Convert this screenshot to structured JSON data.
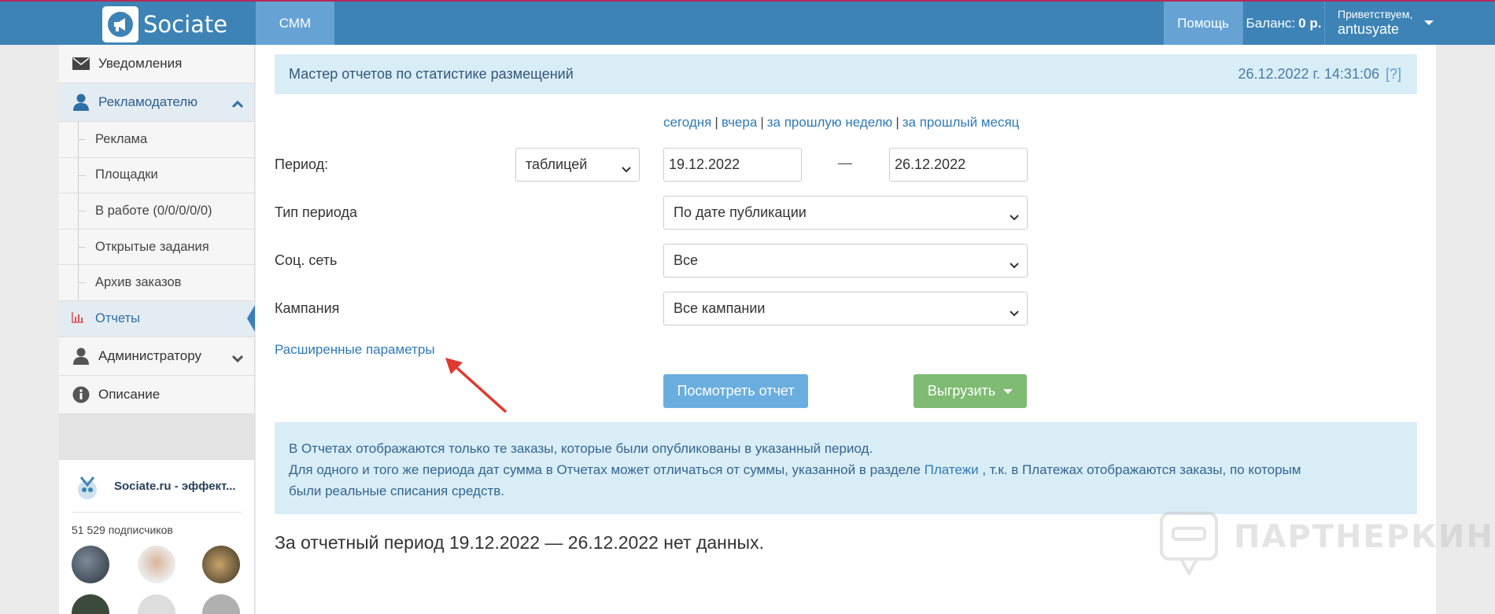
{
  "navbar": {
    "logo_text": "Sociate",
    "smm": "СММ",
    "help": "Помощь",
    "balance_label": "Баланс:",
    "balance_value": "0 р.",
    "greeting": "Приветствуем,",
    "username": "antusyate"
  },
  "sidebar": {
    "notifications": "Уведомления",
    "advertiser": "Рекламодателю",
    "sub": [
      "Реклама",
      "Площадки",
      "В работе (0/0/0/0/0)",
      "Открытые задания",
      "Архив заказов",
      "Отчеты"
    ],
    "admin": "Администратору",
    "description": "Описание"
  },
  "widget": {
    "title": "Sociate.ru - эффект...",
    "subscribers": "51 529 подписчиков"
  },
  "header": {
    "title": "Мастер отчетов по статистике размещений",
    "datetime": "26.12.2022 г. 14:31:06",
    "help": "[?]"
  },
  "quick": {
    "today": "сегодня",
    "yesterday": "вчера",
    "last_week": "за прошлую неделю",
    "last_month": "за прошлый месяц",
    "sep": "|"
  },
  "form": {
    "period_label": "Период:",
    "period_view": "таблицей",
    "date_from": "19.12.2022",
    "date_to": "26.12.2022",
    "dash": "—",
    "period_type_label": "Тип периода",
    "period_type": "По дате публикации",
    "social_label": "Соц. сеть",
    "social": "Все",
    "campaign_label": "Кампания",
    "campaign": "Все кампании",
    "advanced": "Расширенные параметры",
    "view_button": "Посмотреть отчет",
    "export_button": "Выгрузить"
  },
  "info": {
    "line1": "В Отчетах отображаются только те заказы, которые были опубликованы в указанный период.",
    "line2a": "Для одного и того же периода дат сумма в Отчетах может отличаться от суммы, указанной в разделе ",
    "link": "Платежи",
    "line2b": " , т.к. в Платежах отображаются заказы, по которым",
    "line3": "были реальные списания средств."
  },
  "result": "За отчетный период 19.12.2022 — 26.12.2022 нет данных.",
  "watermark": "ПАРТНЕРКИН"
}
